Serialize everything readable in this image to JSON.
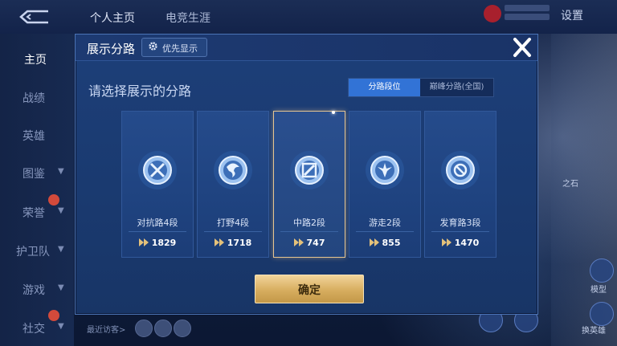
{
  "header": {
    "tabs": [
      {
        "label": "个人主页"
      },
      {
        "label": "电竞生涯"
      }
    ],
    "settings_label": "设置"
  },
  "sidebar": {
    "items": [
      {
        "label": "主页"
      },
      {
        "label": "战绩"
      },
      {
        "label": "英雄"
      },
      {
        "label": "图鉴"
      },
      {
        "label": "荣誉"
      },
      {
        "label": "护卫队"
      },
      {
        "label": "游戏"
      },
      {
        "label": "社交"
      }
    ]
  },
  "footer": {
    "recent_visitors_label": "最近访客>"
  },
  "right_panel": {
    "label_top": "之石",
    "label_model": "模型",
    "label_switch": "换英雄"
  },
  "modal": {
    "title": "展示分路",
    "priority_button": "优先显示",
    "subtitle": "请选择展示的分路",
    "toggle": [
      "分路段位",
      "巅峰分路(全国)"
    ],
    "lanes": [
      {
        "name": "对抗路4段",
        "score": "1829",
        "icon": "clash-lane-icon"
      },
      {
        "name": "打野4段",
        "score": "1718",
        "icon": "jungle-icon"
      },
      {
        "name": "中路2段",
        "score": "747",
        "icon": "mid-lane-icon"
      },
      {
        "name": "游走2段",
        "score": "855",
        "icon": "roam-icon"
      },
      {
        "name": "发育路3段",
        "score": "1470",
        "icon": "farm-lane-icon"
      }
    ],
    "selected_index": 2,
    "confirm_label": "确定"
  },
  "colors": {
    "accent": "#3273d6",
    "gold": "#d7ad5f",
    "panel": "#1d3f79"
  }
}
